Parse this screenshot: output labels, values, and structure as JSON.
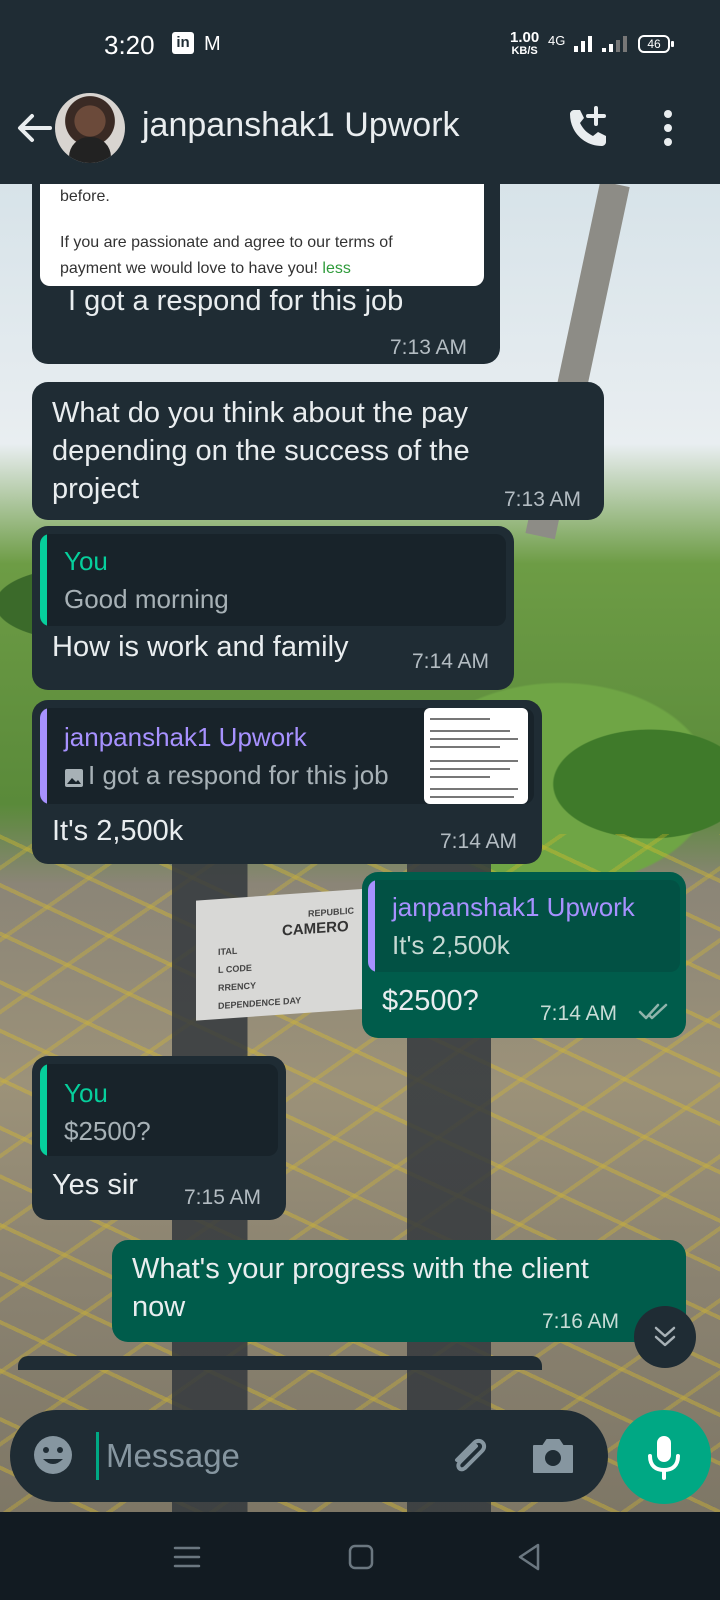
{
  "status_bar": {
    "time": "3:20",
    "linkedin_icon": "in",
    "gmail_icon": "M",
    "net_speed_value": "1.00",
    "net_speed_unit": "KB/S",
    "network": "4G",
    "battery": "46"
  },
  "header": {
    "contact_name": "janpanshak1 Upwork"
  },
  "messages": [
    {
      "direction": "in",
      "preview_lines": [
        "before.",
        "If you are passionate and agree to our terms of",
        "payment we would love to have you!"
      ],
      "preview_less": "less",
      "text": "I got a respond for this job",
      "time": "7:13 AM"
    },
    {
      "direction": "in",
      "text_lines": [
        "What do you think about the pay",
        "depending on the success of the",
        "project"
      ],
      "time": "7:13 AM"
    },
    {
      "direction": "in",
      "quote_author": "You",
      "quote_text": "Good morning",
      "text": "How is work and family",
      "time": "7:14 AM"
    },
    {
      "direction": "in",
      "quote_author": "janpanshak1 Upwork",
      "quote_text": "I got a respond for this job",
      "text": "It's 2,500k",
      "time": "7:14 AM"
    },
    {
      "direction": "out",
      "quote_author": "janpanshak1 Upwork",
      "quote_text": "It's 2,500k",
      "text": "$2500?",
      "time": "7:14 AM",
      "status": "read"
    },
    {
      "direction": "in",
      "quote_author": "You",
      "quote_text": "$2500?",
      "text": "Yes sir",
      "time": "7:15 AM"
    },
    {
      "direction": "out",
      "text_lines": [
        "What's your progress with the client",
        "now"
      ],
      "time": "7:16 AM"
    }
  ],
  "wallpaper": {
    "plaque_lines": [
      "REPUBLIC",
      "CAMERO",
      "ITAL",
      "L CODE",
      "RRENCY",
      "DEPENDENCE DAY"
    ]
  },
  "composer": {
    "placeholder": "Message"
  },
  "colors": {
    "header_bg": "#1f2c34",
    "incoming_bubble": "#1f2c34",
    "outgoing_bubble": "#005c4b",
    "accent_green": "#00a884",
    "quote_you": "#06cf9c",
    "quote_contact": "#a791ff"
  },
  "icons": {
    "back": "arrow-left-icon",
    "call": "add-call-icon",
    "menu": "more-vertical-icon",
    "emoji": "emoji-icon",
    "attach": "paperclip-icon",
    "camera": "camera-icon",
    "mic": "microphone-icon",
    "scroll": "chevron-double-down-icon",
    "read": "double-check-icon"
  }
}
